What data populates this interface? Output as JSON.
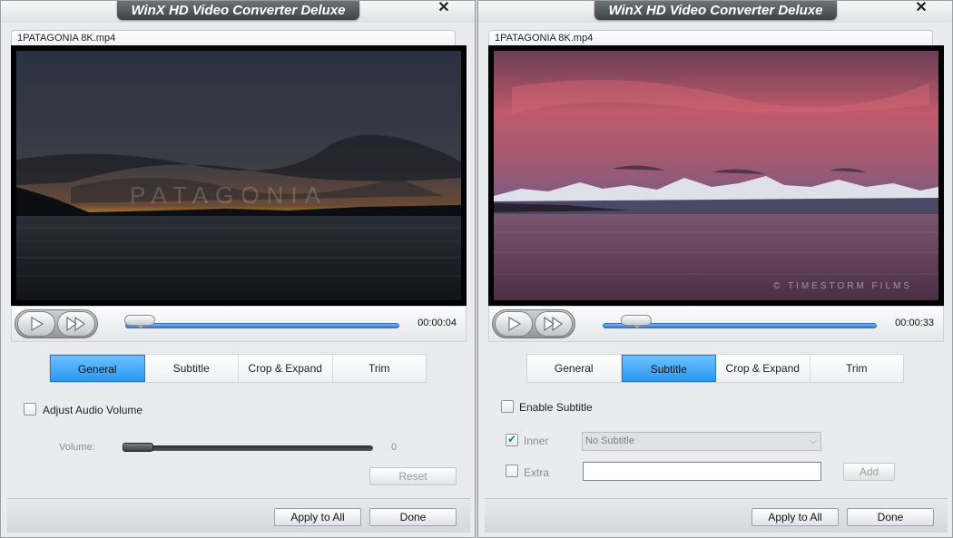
{
  "left": {
    "title": "WinX HD Video Converter Deluxe",
    "close": "✕",
    "filename": "1PATAGONIA 8K.mp4",
    "watermark": "PATAGONIA",
    "time": "00:00:04",
    "seek_position": 0.05,
    "tabs": [
      {
        "label": "General"
      },
      {
        "label": "Subtitle"
      },
      {
        "label": "Crop & Expand"
      },
      {
        "label": "Trim"
      }
    ],
    "active_tab": "General",
    "adjust_audio_label": "Adjust Audio Volume",
    "adjust_audio_checked": false,
    "volume_label": "Volume:",
    "volume_value": "0",
    "reset_label": "Reset",
    "apply_all": "Apply to All",
    "done": "Done"
  },
  "right": {
    "title": "WinX HD Video Converter Deluxe",
    "close": "✕",
    "filename": "1PATAGONIA 8K.mp4",
    "watermark": "© TIMESTORM FILMS",
    "time": "00:00:33",
    "seek_position": 0.12,
    "tabs": [
      {
        "label": "General"
      },
      {
        "label": "Subtitle"
      },
      {
        "label": "Crop & Expand"
      },
      {
        "label": "Trim"
      }
    ],
    "active_tab": "Subtitle",
    "enable_subtitle_label": "Enable Subtitle",
    "enable_subtitle_checked": false,
    "inner_label": "Inner",
    "inner_checked": true,
    "subtitle_select": "No Subtitle",
    "extra_label": "Extra",
    "extra_checked": false,
    "extra_value": "",
    "add_label": "Add",
    "apply_all": "Apply to All",
    "done": "Done"
  },
  "colors": {
    "accent_tab": "#2a98f0",
    "window_bg": "#e9ebee",
    "title_tab": "#4a4e52"
  },
  "icons": [
    "play-icon",
    "fast-forward-icon",
    "close-icon",
    "chevron-down-icon",
    "check-icon"
  ]
}
